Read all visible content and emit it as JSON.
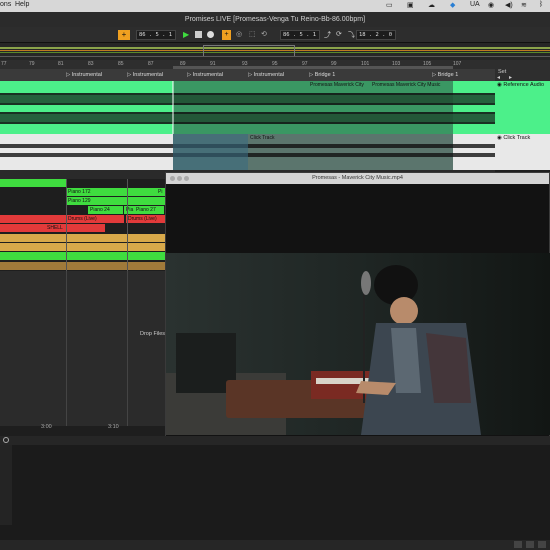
{
  "menubar": {
    "help_label": "Help",
    "input_source": "UA"
  },
  "titlebar": {
    "title": "Promises LIVE  [Promesas-Venga Tu Reino-Bb-86.00bpm]"
  },
  "transport": {
    "position": "86 . 5 . 1",
    "loop_start": "86 . 5 . 1",
    "loop_length": "18 . 2 . 0"
  },
  "ruler": {
    "bars": [
      "77",
      "79",
      "81",
      "83",
      "85",
      "87",
      "89",
      "91",
      "93",
      "95",
      "97",
      "99",
      "101",
      "103",
      "105",
      "107"
    ]
  },
  "locators": [
    {
      "label": "Instrumental"
    },
    {
      "label": "Instrumental"
    },
    {
      "label": "Instrumental"
    },
    {
      "label": "Instrumental"
    },
    {
      "label": "Bridge 1"
    },
    {
      "label": "Bridge 1"
    }
  ],
  "set_label": "Set",
  "tracks": {
    "reference": {
      "name": "Reference Audio",
      "clips": [
        "Promesas  Maverick City",
        "Promesas  Maverick City Music"
      ]
    },
    "click": {
      "name": "Click Track",
      "clip": "Click Track"
    },
    "midi_clips": [
      {
        "label": "Piano 172"
      },
      {
        "label": "Piano 129"
      },
      {
        "label": "Piano 24"
      },
      {
        "label": "Pia"
      },
      {
        "label": "Piano 27"
      },
      {
        "label": "Pi"
      },
      {
        "label": "Drums (Live)"
      },
      {
        "label": "Drums (Live)"
      },
      {
        "label": "SHELL"
      }
    ],
    "drop_files": "Drop Files",
    "time_markers": [
      "3:00",
      "3:10"
    ]
  },
  "video": {
    "title": "Promesas - Maverick City Music.mp4"
  },
  "colors": {
    "green": "#3fdc3f",
    "reference_green": "#4cf08a",
    "red": "#e23a3a",
    "tan": "#d8a94a",
    "orange": "#f0a020"
  }
}
